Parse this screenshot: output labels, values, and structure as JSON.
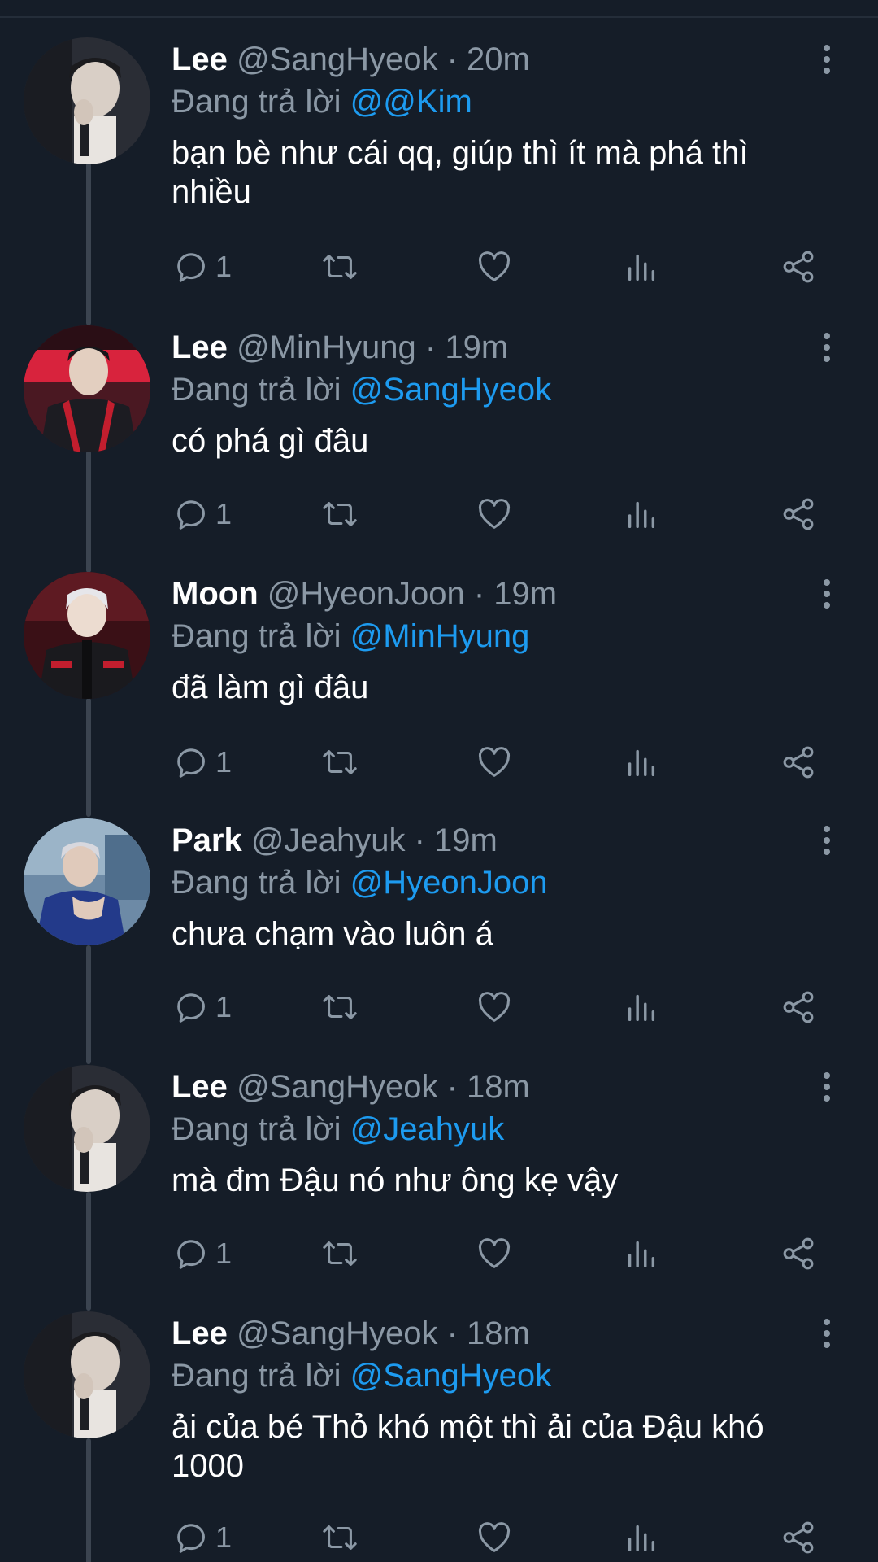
{
  "thread": [
    {
      "name": "Lee",
      "handle": "@SangHyeok",
      "sep": "·",
      "time": "20m",
      "replying_to_label": "Đang trả lời",
      "replying_to": "@@Kim",
      "text": "bạn bè như cái qq, giúp thì ít mà phá thì nhiều",
      "reply_count": "1",
      "avatar_icon": "avatar-photo"
    },
    {
      "name": "Lee",
      "handle": "@MinHyung",
      "sep": "·",
      "time": "19m",
      "replying_to_label": "Đang trả lời",
      "replying_to": "@SangHyeok",
      "text": "có phá gì đâu",
      "reply_count": "1",
      "avatar_icon": "avatar-photo"
    },
    {
      "name": "Moon",
      "handle": "@HyeonJoon",
      "sep": "·",
      "time": "19m",
      "replying_to_label": "Đang trả lời",
      "replying_to": "@MinHyung",
      "text": "đã làm gì đâu",
      "reply_count": "1",
      "avatar_icon": "avatar-photo"
    },
    {
      "name": "Park",
      "handle": "@Jeahyuk",
      "sep": "·",
      "time": "19m",
      "replying_to_label": "Đang trả lời",
      "replying_to": "@HyeonJoon",
      "text": "chưa chạm vào luôn á",
      "reply_count": "1",
      "avatar_icon": "avatar-photo"
    },
    {
      "name": "Lee",
      "handle": "@SangHyeok",
      "sep": "·",
      "time": "18m",
      "replying_to_label": "Đang trả lời",
      "replying_to": "@Jeahyuk",
      "text": "mà đm Đậu nó như ông kẹ vậy",
      "reply_count": "1",
      "avatar_icon": "avatar-photo"
    },
    {
      "name": "Lee",
      "handle": "@SangHyeok",
      "sep": "·",
      "time": "18m",
      "replying_to_label": "Đang trả lời",
      "replying_to": "@SangHyeok",
      "text": "ải của bé Thỏ khó một thì ải của Đậu khó 1000",
      "reply_count": "1",
      "avatar_icon": "avatar-photo"
    }
  ],
  "icons": {
    "reply": "reply-icon",
    "retweet": "retweet-icon",
    "like": "heart-icon",
    "stats": "stats-icon",
    "share": "share-icon",
    "more": "more-vertical-icon"
  },
  "colors": {
    "background": "#151d28",
    "mention": "#1d9bf0",
    "muted": "#8b98a5",
    "text": "#ffffff"
  }
}
